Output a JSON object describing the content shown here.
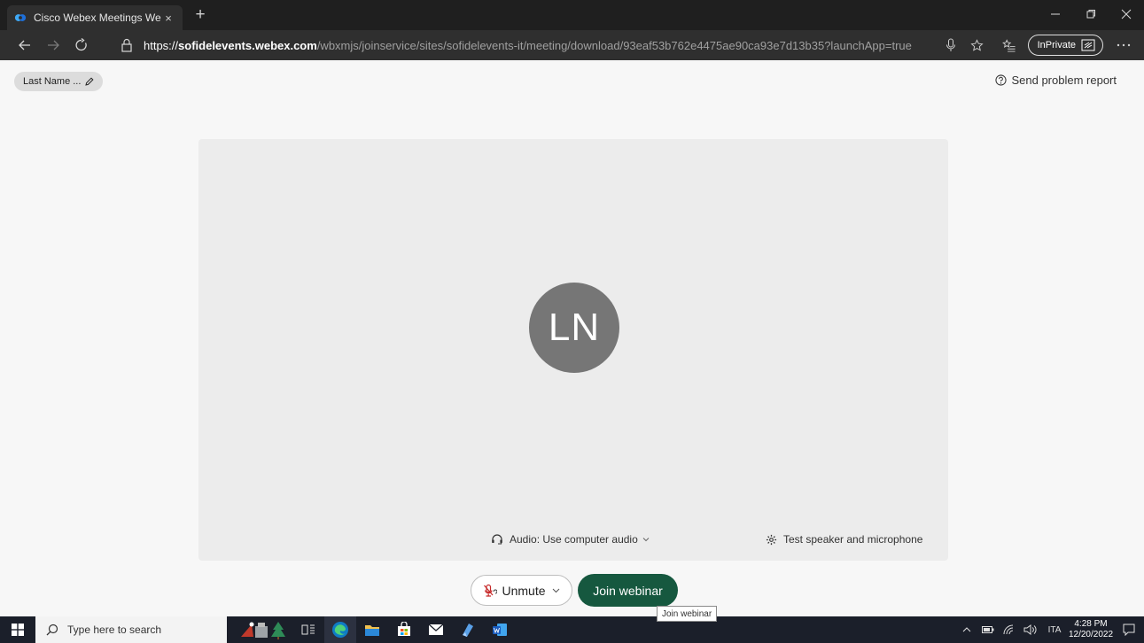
{
  "browser": {
    "tab_title": "Cisco Webex Meetings Web App",
    "tab_close": "×",
    "new_tab": "+",
    "url": {
      "protocol": "https://",
      "host": "sofidelevents.webex.com",
      "path": "/wbxmjs/joinservice/sites/sofidelevents-it/meeting/download/93eaf53b762e4475ae90ca93e7d13b35?launchApp=true"
    },
    "inprivate_label": "InPrivate"
  },
  "page": {
    "name_chip": "Last Name ...",
    "send_problem_report": "Send problem report",
    "avatar_initials": "LN",
    "audio_label": "Audio: Use computer audio",
    "test_speaker_label": "Test speaker and microphone",
    "unmute_label": "Unmute",
    "join_label": "Join webinar",
    "tooltip": "Join webinar"
  },
  "taskbar": {
    "search_placeholder": "Type here to search",
    "language": "ITA",
    "time": "4:28 PM",
    "date": "12/20/2022"
  },
  "colors": {
    "join_button": "#16583f",
    "avatar": "#767676",
    "chrome_dark": "#2f2f2f"
  }
}
